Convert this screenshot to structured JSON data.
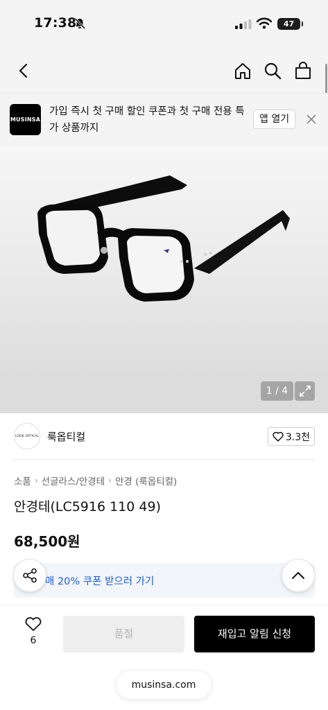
{
  "status_bar": {
    "time": "17:38",
    "battery": "47",
    "icons": [
      "bell-slash-icon",
      "signal-icon",
      "wifi-icon",
      "battery-icon"
    ]
  },
  "nav": {
    "icons": [
      "back-icon",
      "home-icon",
      "search-icon",
      "shopping-bag-icon"
    ]
  },
  "app_banner": {
    "logo": "MUSINSA",
    "message": "가입 즉시 첫 구매 할인 쿠폰과 첫 구매 전용 특가 상품까지",
    "open_label": "앱 열기",
    "close_icon": "close-icon"
  },
  "gallery": {
    "counter": "1 / 4",
    "expand_icon": "expand-icon"
  },
  "brand": {
    "logo_text": "LOOK OPTICAL",
    "name": "룩옵티컬",
    "likes": "3.3천"
  },
  "breadcrumb": [
    "소품",
    "선글라스/안경테",
    "안경 (룩옵티컬)"
  ],
  "product": {
    "title": "안경테(LC5916 110 49)",
    "price": "68,500원"
  },
  "coupon": {
    "text": "매 20% 쿠폰 받으러 가기"
  },
  "bottom": {
    "wish_count": "6",
    "soldout_label": "품절",
    "restock_label": "재입고 알림 신청"
  },
  "url": "musinsa.com",
  "colors": {
    "accent": "#1e5fd6",
    "black": "#000000",
    "disabled_bg": "#eeeeee",
    "header_bg": "#f4f4f4"
  }
}
